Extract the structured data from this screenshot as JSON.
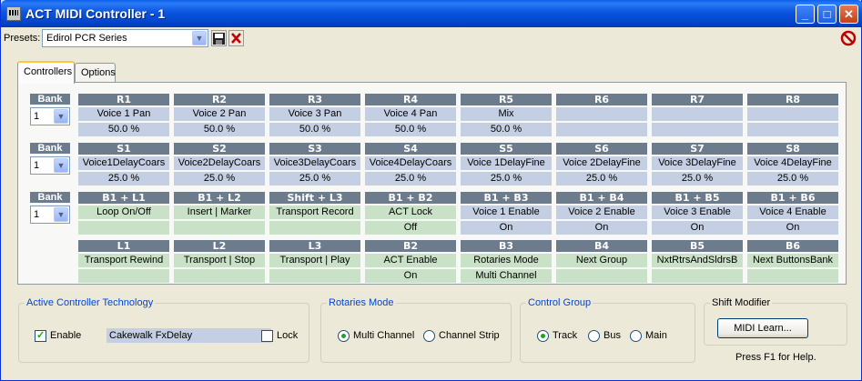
{
  "window": {
    "title": "ACT MIDI Controller - 1",
    "buttons": {
      "minimize": "_",
      "maximize": "□",
      "close": "✕"
    }
  },
  "presets": {
    "label": "Presets:",
    "value": "Edirol PCR Series"
  },
  "tabs": [
    {
      "label": "Controllers",
      "active": true
    },
    {
      "label": "Options",
      "active": false
    }
  ],
  "banks": [
    {
      "label": "Bank",
      "value": "1"
    },
    {
      "label": "Bank",
      "value": "1"
    },
    {
      "label": "Bank",
      "value": "1"
    }
  ],
  "rows": [
    {
      "style": "blue",
      "controls": [
        {
          "name": "R1",
          "f1": "Voice 1 Pan",
          "f2": "50.0 %"
        },
        {
          "name": "R2",
          "f1": "Voice 2 Pan",
          "f2": "50.0 %"
        },
        {
          "name": "R3",
          "f1": "Voice 3 Pan",
          "f2": "50.0 %"
        },
        {
          "name": "R4",
          "f1": "Voice 4 Pan",
          "f2": "50.0 %"
        },
        {
          "name": "R5",
          "f1": "Mix",
          "f2": "50.0 %"
        },
        {
          "name": "R6",
          "f1": "",
          "f2": ""
        },
        {
          "name": "R7",
          "f1": "",
          "f2": ""
        },
        {
          "name": "R8",
          "f1": "",
          "f2": ""
        }
      ]
    },
    {
      "style": "blue",
      "controls": [
        {
          "name": "S1",
          "f1": "Voice1DelayCoars",
          "f2": "25.0 %"
        },
        {
          "name": "S2",
          "f1": "Voice2DelayCoars",
          "f2": "25.0 %"
        },
        {
          "name": "S3",
          "f1": "Voice3DelayCoars",
          "f2": "25.0 %"
        },
        {
          "name": "S4",
          "f1": "Voice4DelayCoars",
          "f2": "25.0 %"
        },
        {
          "name": "S5",
          "f1": "Voice 1DelayFine",
          "f2": "25.0 %"
        },
        {
          "name": "S6",
          "f1": "Voice 2DelayFine",
          "f2": "25.0 %"
        },
        {
          "name": "S7",
          "f1": "Voice 3DelayFine",
          "f2": "25.0 %"
        },
        {
          "name": "S8",
          "f1": "Voice 4DelayFine",
          "f2": "25.0 %"
        }
      ]
    },
    {
      "style": "mixed",
      "controls": [
        {
          "name": "B1 + L1",
          "f1": "Loop On/Off",
          "f2": "",
          "color": "green"
        },
        {
          "name": "B1 + L2",
          "f1": "Insert | Marker",
          "f2": "",
          "color": "green"
        },
        {
          "name": "Shift + L3",
          "f1": "Transport Record",
          "f2": "",
          "color": "green"
        },
        {
          "name": "B1 + B2",
          "f1": "ACT Lock",
          "f2": "Off",
          "color": "green"
        },
        {
          "name": "B1 + B3",
          "f1": "Voice 1 Enable",
          "f2": "On",
          "color": "blue"
        },
        {
          "name": "B1 + B4",
          "f1": "Voice 2 Enable",
          "f2": "On",
          "color": "blue"
        },
        {
          "name": "B1 + B5",
          "f1": "Voice 3 Enable",
          "f2": "On",
          "color": "blue"
        },
        {
          "name": "B1 + B6",
          "f1": "Voice 4 Enable",
          "f2": "On",
          "color": "blue"
        }
      ]
    },
    {
      "style": "green",
      "controls": [
        {
          "name": "L1",
          "f1": "Transport Rewind",
          "f2": ""
        },
        {
          "name": "L2",
          "f1": "Transport | Stop",
          "f2": ""
        },
        {
          "name": "L3",
          "f1": "Transport | Play",
          "f2": ""
        },
        {
          "name": "B2",
          "f1": "ACT Enable",
          "f2": "On"
        },
        {
          "name": "B3",
          "f1": "Rotaries Mode",
          "f2": "Multi Channel"
        },
        {
          "name": "B4",
          "f1": "Next Group",
          "f2": ""
        },
        {
          "name": "B5",
          "f1": "NxtRtrsAndSldrsB",
          "f2": ""
        },
        {
          "name": "B6",
          "f1": "Next ButtonsBank",
          "f2": ""
        }
      ]
    }
  ],
  "act": {
    "title": "Active Controller Technology",
    "enable_label": "Enable",
    "enabled": true,
    "plugin": "Cakewalk FxDelay",
    "lock_label": "Lock",
    "locked": false
  },
  "rotaries": {
    "title": "Rotaries Mode",
    "options": [
      "Multi Channel",
      "Channel Strip"
    ],
    "selected": "Multi Channel"
  },
  "control_group": {
    "title": "Control Group",
    "options": [
      "Track",
      "Bus",
      "Main"
    ],
    "selected": "Track"
  },
  "shift": {
    "title": "Shift Modifier",
    "button": "MIDI Learn..."
  },
  "help": "Press F1 for Help.",
  "colors": {
    "header": "#6d7c8c",
    "blue_field": "#c4cfe3",
    "green_field": "#c9e2c7",
    "group_title": "#0046d5"
  }
}
